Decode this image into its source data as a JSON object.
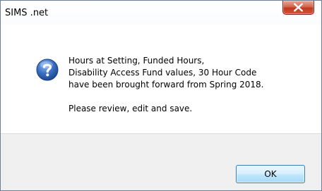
{
  "window": {
    "title": "SIMS .net"
  },
  "icons": {
    "close": "close-icon",
    "message_icon": "question-icon"
  },
  "message": {
    "lines": [
      "Hours at Setting, Funded Hours,",
      "Disability Access Fund values, 30 Hour Code",
      "have been brought forward from Spring 2018."
    ],
    "instruction": "Please review, edit and save."
  },
  "buttons": {
    "ok_label": "OK"
  },
  "colors": {
    "close_button": "#c7432a",
    "question_icon": "#2b5ea8",
    "footer_background": "#f0f0f0",
    "ok_button_border": "#3c7fb1"
  }
}
